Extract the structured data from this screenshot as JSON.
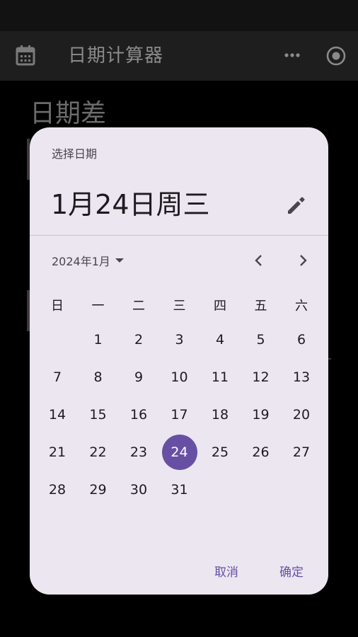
{
  "app": {
    "title": "日期计算器",
    "page_heading": "日期差"
  },
  "dialog": {
    "label": "选择日期",
    "headline": "1月24日周三",
    "month_year": "2024年1月",
    "weekdays": [
      "日",
      "一",
      "二",
      "三",
      "四",
      "五",
      "六"
    ],
    "first_weekday_index": 1,
    "days_in_month": 31,
    "selected_day": "24",
    "days": [
      "1",
      "2",
      "3",
      "4",
      "5",
      "6",
      "7",
      "8",
      "9",
      "10",
      "11",
      "12",
      "13",
      "14",
      "15",
      "16",
      "17",
      "18",
      "19",
      "20",
      "21",
      "22",
      "23",
      "24",
      "25",
      "26",
      "27",
      "28",
      "29",
      "30",
      "31"
    ],
    "cancel_label": "取消",
    "confirm_label": "确定"
  },
  "icons": {
    "appbar_left": "calendar-icon",
    "appbar_more": "more-horiz-icon",
    "appbar_right": "target-icon",
    "edit": "pencil-icon",
    "dropdown": "caret-down-icon",
    "prev": "chevron-left-icon",
    "next": "chevron-right-icon"
  },
  "colors": {
    "dialog_bg": "#ece6f0",
    "accent": "#6750a4",
    "text_primary": "#1d1b20",
    "text_secondary": "#49454f"
  }
}
